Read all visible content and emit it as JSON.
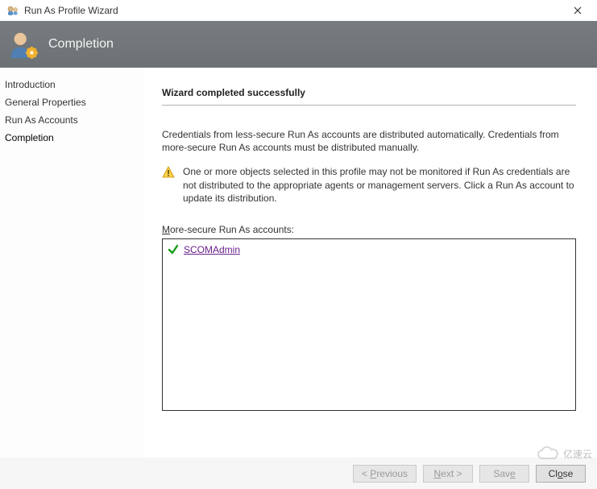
{
  "window": {
    "title": "Run As Profile Wizard"
  },
  "banner": {
    "title": "Completion"
  },
  "sidebar": {
    "items": [
      {
        "label": "Introduction"
      },
      {
        "label": "General Properties"
      },
      {
        "label": "Run As Accounts"
      },
      {
        "label": "Completion"
      }
    ],
    "active_index": 3
  },
  "content": {
    "heading": "Wizard completed successfully",
    "description": "Credentials from less-secure Run As accounts are distributed automatically. Credentials from more-secure Run As accounts must be distributed manually.",
    "warning_text": "One or more objects selected in this profile may not be monitored if Run As credentials are not distributed to the appropriate agents or management servers. Click a Run As account to update its distribution.",
    "list_label_prefix": "M",
    "list_label_rest": "ore-secure Run As accounts:",
    "accounts": [
      {
        "name": "SCOMAdmin"
      }
    ]
  },
  "footer": {
    "previous_hotkey": "P",
    "previous_rest": "revious",
    "next_hotkey": "N",
    "next_rest": "ext >",
    "save_pre": "Sav",
    "save_hotkey": "e",
    "close_pre": "Cl",
    "close_hotkey": "o",
    "close_rest": "se"
  },
  "watermark": {
    "text": "亿速云"
  }
}
